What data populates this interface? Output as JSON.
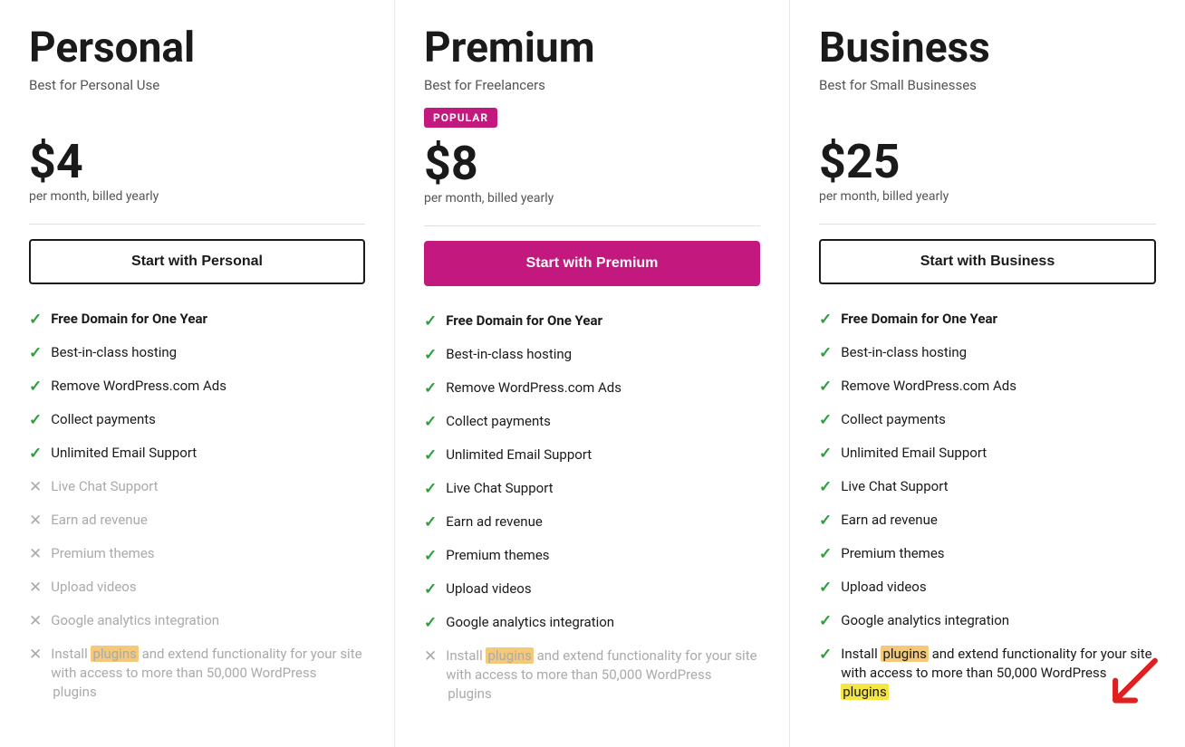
{
  "plans": [
    {
      "id": "personal",
      "name": "Personal",
      "tagline": "Best for Personal Use",
      "popular": false,
      "price": "$4",
      "billing": "per month, billed yearly",
      "cta": "Start with Personal",
      "ctaStyle": "outline",
      "features": [
        {
          "text": "Free Domain for One Year",
          "included": true,
          "bold": true
        },
        {
          "text": "Best-in-class hosting",
          "included": true,
          "bold": false
        },
        {
          "text": "Remove WordPress.com Ads",
          "included": true,
          "bold": false
        },
        {
          "text": "Collect payments",
          "included": true,
          "bold": false
        },
        {
          "text": "Unlimited Email Support",
          "included": true,
          "bold": false
        },
        {
          "text": "Live Chat Support",
          "included": false,
          "bold": false
        },
        {
          "text": "Earn ad revenue",
          "included": false,
          "bold": false
        },
        {
          "text": "Premium themes",
          "included": false,
          "bold": false
        },
        {
          "text": "Upload videos",
          "included": false,
          "bold": false
        },
        {
          "text": "Google analytics integration",
          "included": false,
          "bold": false
        },
        {
          "text": "Install",
          "plugin_text": "plugins",
          "plugin_style": "orange",
          "suffix": " and extend functionality for your site with access to more than 50,000 WordPress ",
          "suffix_plugin": "plugins",
          "suffix_plugin_style": "none",
          "included": false,
          "bold": false,
          "isPlugin": true
        }
      ]
    },
    {
      "id": "premium",
      "name": "Premium",
      "tagline": "Best for Freelancers",
      "popular": true,
      "price": "$8",
      "billing": "per month, billed yearly",
      "cta": "Start with Premium",
      "ctaStyle": "filled",
      "features": [
        {
          "text": "Free Domain for One Year",
          "included": true,
          "bold": true
        },
        {
          "text": "Best-in-class hosting",
          "included": true,
          "bold": false
        },
        {
          "text": "Remove WordPress.com Ads",
          "included": true,
          "bold": false
        },
        {
          "text": "Collect payments",
          "included": true,
          "bold": false
        },
        {
          "text": "Unlimited Email Support",
          "included": true,
          "bold": false
        },
        {
          "text": "Live Chat Support",
          "included": true,
          "bold": false
        },
        {
          "text": "Earn ad revenue",
          "included": true,
          "bold": false
        },
        {
          "text": "Premium themes",
          "included": true,
          "bold": false
        },
        {
          "text": "Upload videos",
          "included": true,
          "bold": false
        },
        {
          "text": "Google analytics integration",
          "included": true,
          "bold": false
        },
        {
          "text": "Install",
          "plugin_text": "plugins",
          "plugin_style": "orange",
          "suffix": " and extend functionality for your site with access to more than 50,000 WordPress ",
          "suffix_plugin": "plugins",
          "suffix_plugin_style": "none",
          "included": false,
          "bold": false,
          "isPlugin": true
        }
      ]
    },
    {
      "id": "business",
      "name": "Business",
      "tagline": "Best for Small Businesses",
      "popular": false,
      "price": "$25",
      "billing": "per month, billed yearly",
      "cta": "Start with Business",
      "ctaStyle": "outline",
      "features": [
        {
          "text": "Free Domain for One Year",
          "included": true,
          "bold": true
        },
        {
          "text": "Best-in-class hosting",
          "included": true,
          "bold": false
        },
        {
          "text": "Remove WordPress.com Ads",
          "included": true,
          "bold": false
        },
        {
          "text": "Collect payments",
          "included": true,
          "bold": false
        },
        {
          "text": "Unlimited Email Support",
          "included": true,
          "bold": false
        },
        {
          "text": "Live Chat Support",
          "included": true,
          "bold": false
        },
        {
          "text": "Earn ad revenue",
          "included": true,
          "bold": false
        },
        {
          "text": "Premium themes",
          "included": true,
          "bold": false
        },
        {
          "text": "Upload videos",
          "included": true,
          "bold": false
        },
        {
          "text": "Google analytics integration",
          "included": true,
          "bold": false
        },
        {
          "text": "Install",
          "plugin_text": "plugins",
          "plugin_style": "orange",
          "suffix": " and extend functionality for your site with access to more than 50,000 WordPress ",
          "suffix_plugin": "plugins",
          "suffix_plugin_style": "yellow",
          "included": true,
          "bold": false,
          "isPlugin": true
        }
      ]
    }
  ],
  "popular_label": "POPULAR"
}
